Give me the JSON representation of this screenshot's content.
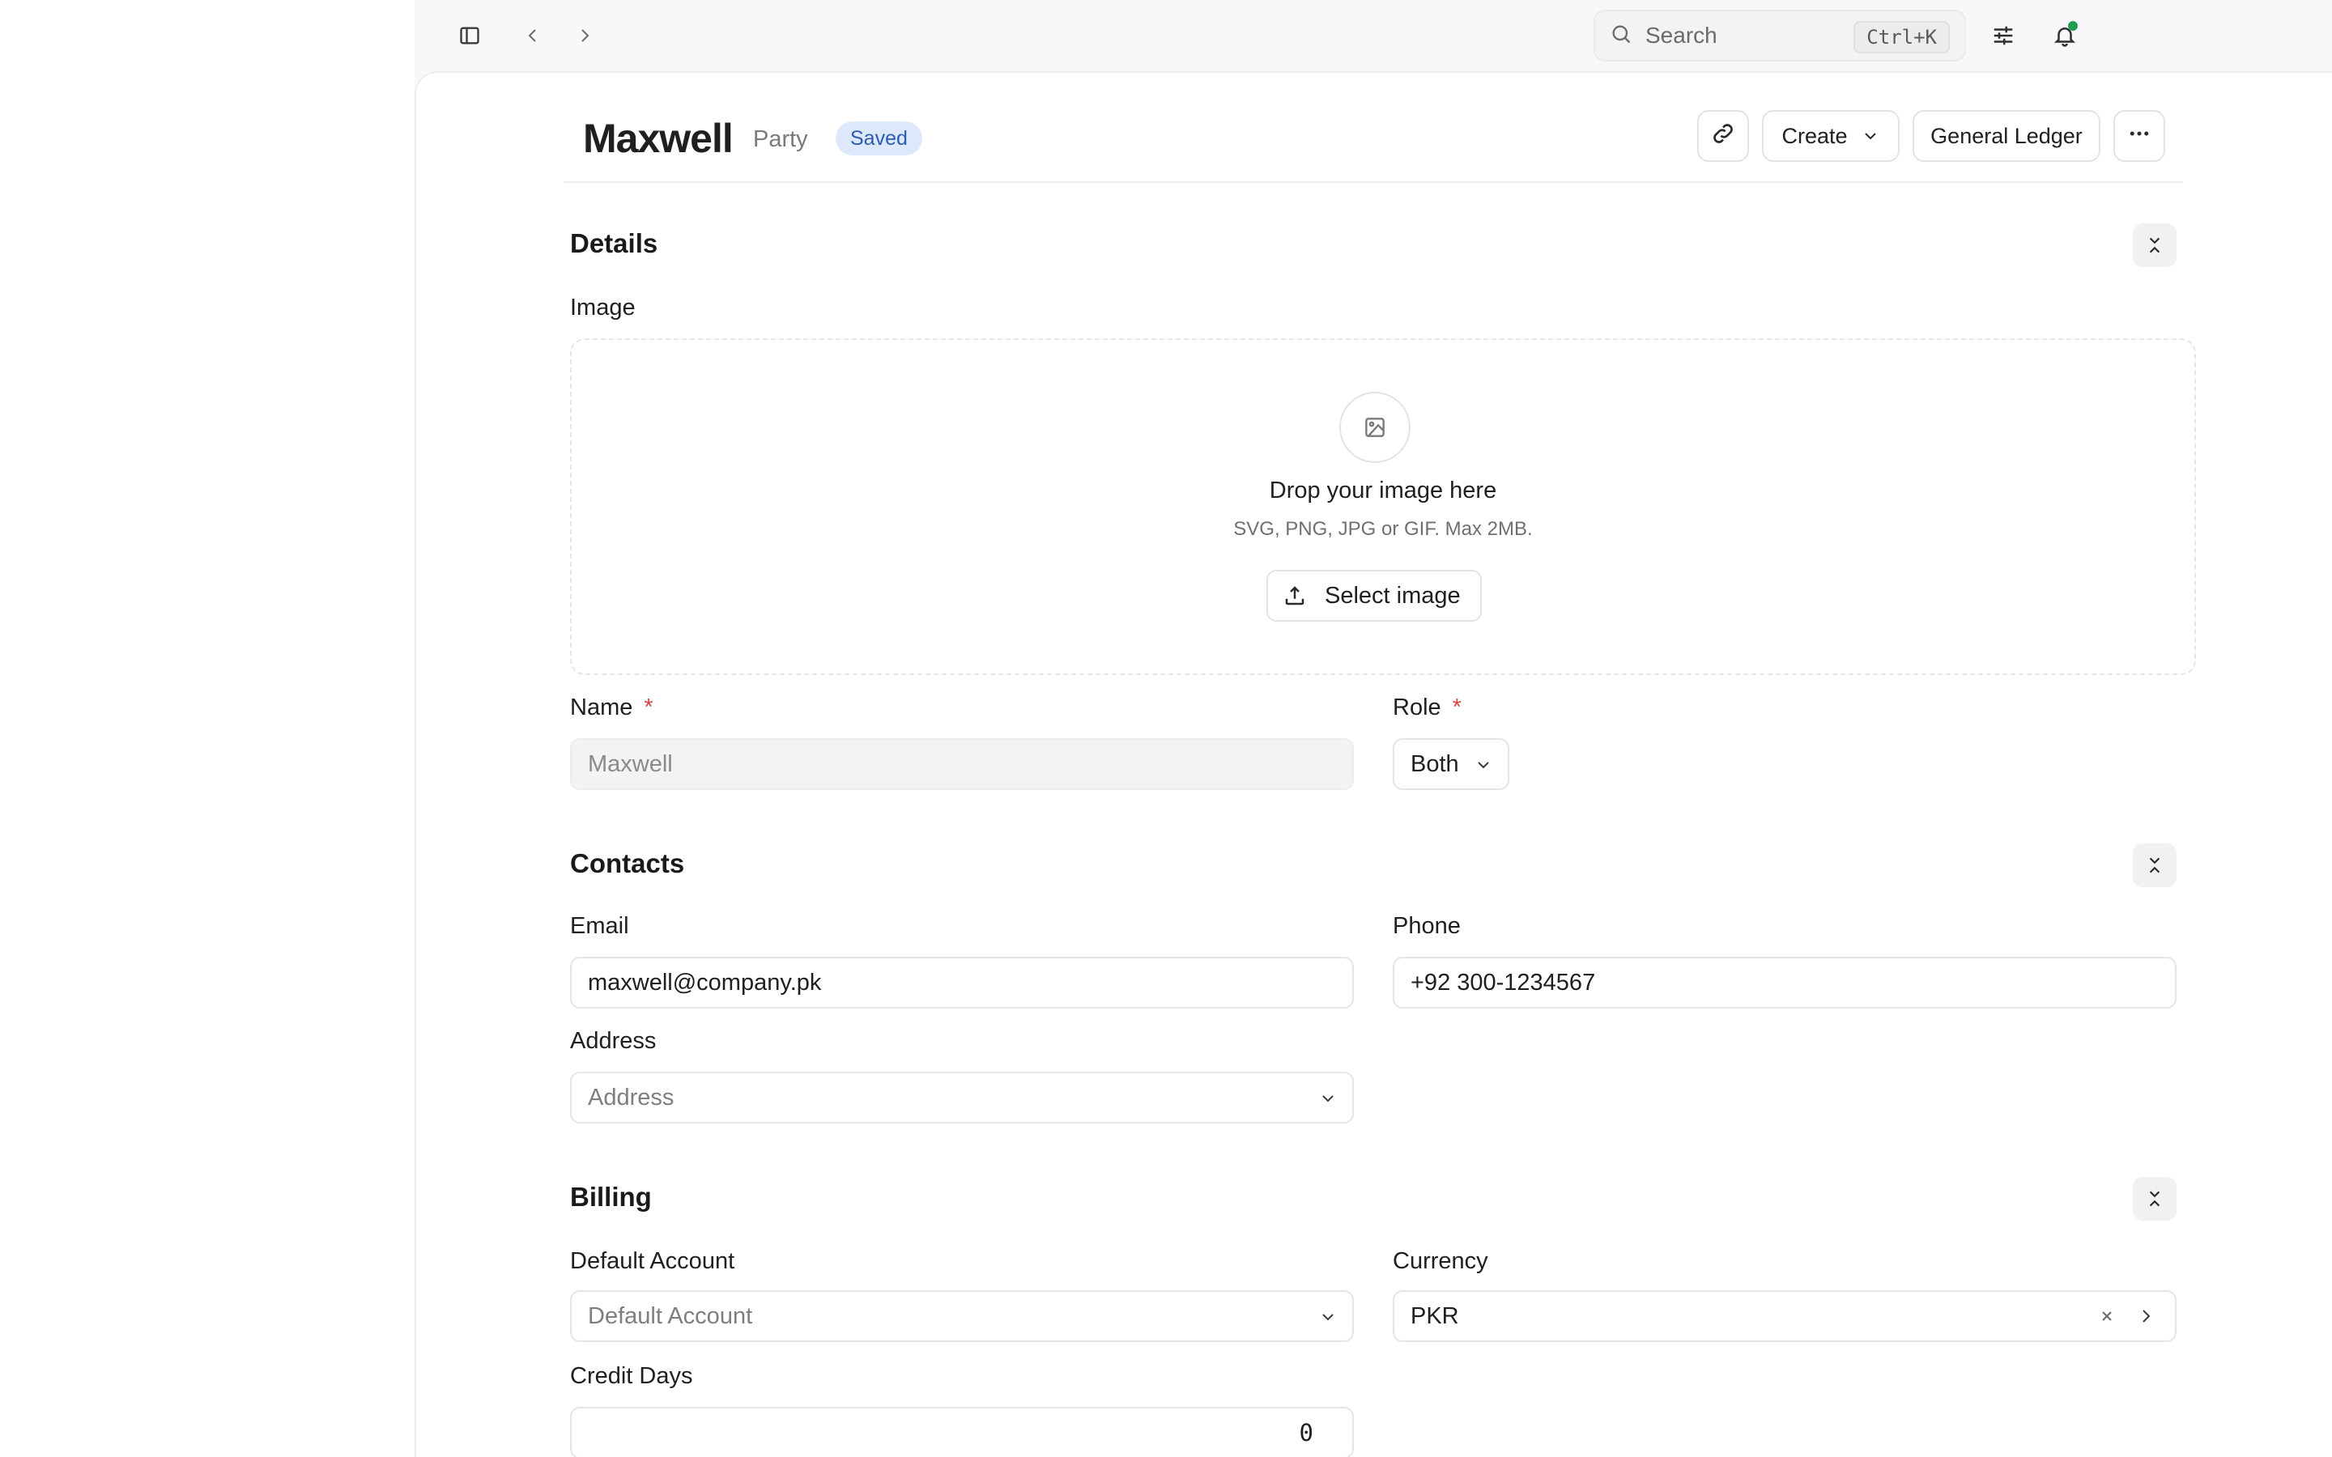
{
  "topbar": {
    "search_placeholder": "Search",
    "search_shortcut": "Ctrl+K",
    "icons": [
      "sidebar-toggle-icon",
      "chevron-left-icon",
      "chevron-right-icon",
      "search-icon",
      "sliders-icon",
      "bell-icon"
    ],
    "notification_dot_color": "#1f9d55"
  },
  "header": {
    "title": "Maxwell",
    "doctype": "Party",
    "status": "Saved",
    "create_label": "Create",
    "ledger_label": "General Ledger"
  },
  "details": {
    "title": "Details",
    "image_label": "Image",
    "drop_title": "Drop your image here",
    "drop_subtitle": "SVG, PNG, JPG or GIF. Max 2MB.",
    "select_image_label": "Select image",
    "name_label": "Name",
    "name_value": "Maxwell",
    "role_label": "Role",
    "role_value": "Both",
    "required_mark": "*"
  },
  "contacts": {
    "title": "Contacts",
    "email_label": "Email",
    "email_value": "maxwell@company.pk",
    "phone_label": "Phone",
    "phone_value": "+92 300-1234567",
    "address_label": "Address",
    "address_placeholder": "Address"
  },
  "billing": {
    "title": "Billing",
    "default_account_label": "Default Account",
    "default_account_placeholder": "Default Account",
    "currency_label": "Currency",
    "currency_value": "PKR",
    "credit_days_label": "Credit Days",
    "credit_days_value": "0"
  }
}
